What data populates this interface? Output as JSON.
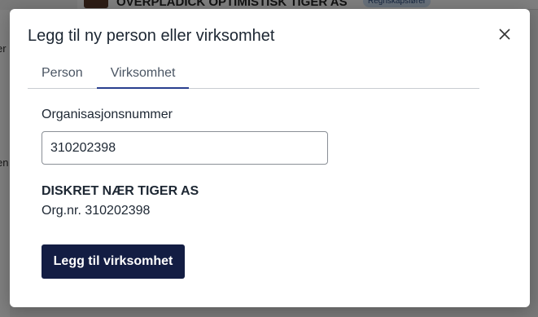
{
  "background": {
    "company_name": "OVERPLADICK OPTIMISTISK TIGER AS",
    "badge": "Regnskapsfører",
    "left_text_1": "er",
    "left_text_2": "en"
  },
  "modal": {
    "title": "Legg til ny person eller virksomhet",
    "close_icon": "close-icon",
    "tabs": [
      {
        "label": "Person",
        "active": false
      },
      {
        "label": "Virksomhet",
        "active": true
      }
    ],
    "org_field": {
      "label": "Organisasjonsnummer",
      "value": "310202398"
    },
    "result": {
      "name": "DISKRET NÆR TIGER AS",
      "orgnr": "Org.nr. 310202398"
    },
    "add_button_label": "Legg til virksomhet"
  },
  "colors": {
    "primary_button": "#131d43",
    "active_tab_underline": "#2a3f8f"
  }
}
